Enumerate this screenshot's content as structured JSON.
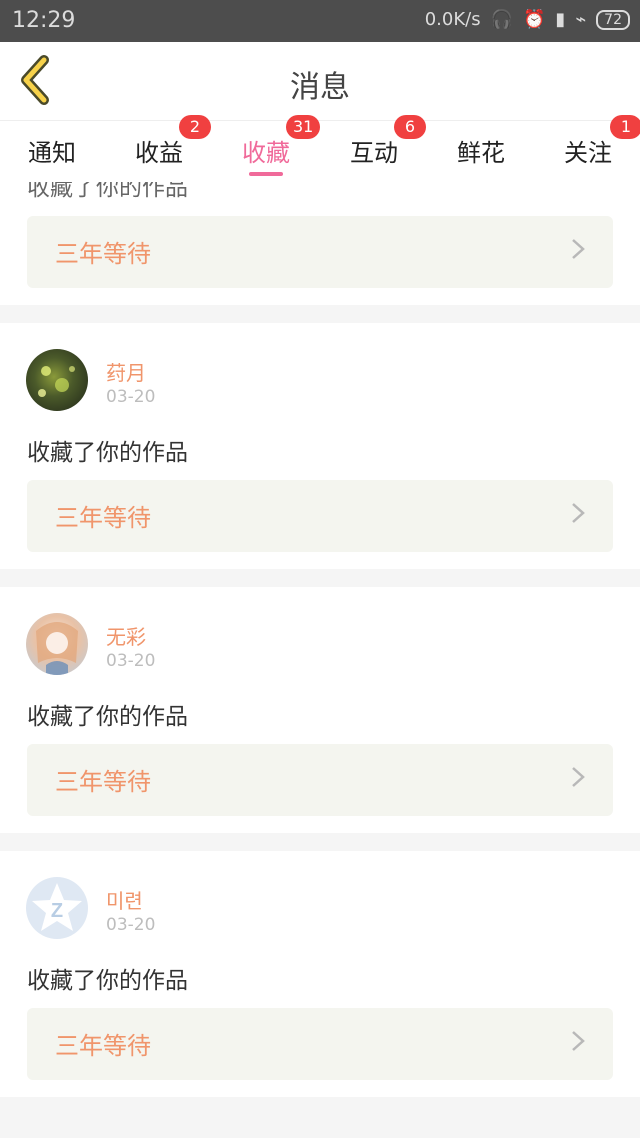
{
  "status": {
    "time": "12:29",
    "network_speed": "0.0K/s",
    "battery": "72"
  },
  "header": {
    "title": "消息"
  },
  "tabs": [
    {
      "label": "通知",
      "badge": ""
    },
    {
      "label": "收益",
      "badge": "2"
    },
    {
      "label": "收藏",
      "badge": "31",
      "active": true
    },
    {
      "label": "互动",
      "badge": "6"
    },
    {
      "label": "鲜花",
      "badge": ""
    },
    {
      "label": "关注",
      "badge": "1"
    }
  ],
  "top_partial": {
    "message": "收藏了你的作品",
    "work": "三年等待"
  },
  "items": [
    {
      "user": "荮月",
      "date": "03-20",
      "message": "收藏了你的作品",
      "work": "三年等待"
    },
    {
      "user": "无彩",
      "date": "03-20",
      "message": "收藏了你的作品",
      "work": "三年等待"
    },
    {
      "user": "미련",
      "date": "03-20",
      "message": "收藏了你的作品",
      "work": "三年等待"
    }
  ],
  "colors": {
    "accent_pink": "#f06a9a",
    "work_text": "#f0956b",
    "badge_red": "#f04040"
  }
}
